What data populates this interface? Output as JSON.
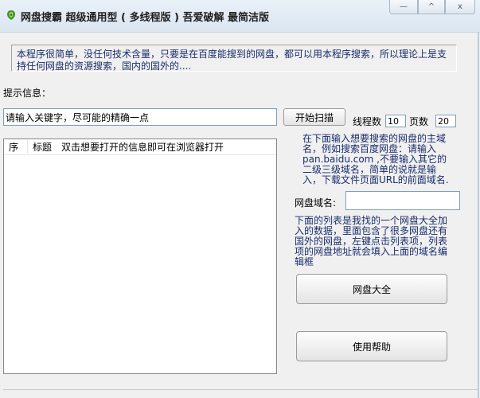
{
  "window": {
    "title": "网盘搜霸 超级通用型 ( 多线程版 )   吾爱破解 最简洁版",
    "minimize_label": "—",
    "maximize_label": "^",
    "close_label": "x"
  },
  "intro_text": "本程序很简单，没任何技术含量，只要是在百度能搜到的网盘，都可以用本程序搜索，所以理论上是支持任何网盘的资源搜索，国内的国外的....",
  "hint_label": "提示信息：",
  "keyword_input": {
    "value": "请输入关键字，尽可能的精确一点"
  },
  "scan_button": "开始扫描",
  "threads": {
    "label": "线程数",
    "value": "10"
  },
  "pages": {
    "label": "页数",
    "value": "20"
  },
  "result_list": {
    "columns": [
      "序",
      "标题",
      "双击想要打开的信息即可在浏览器打开"
    ]
  },
  "description_top": "在下面输入想要搜索的网盘的主域名，例如搜索百度网盘：请输入pan.baidu.com ,不要输入其它的二级三级域名，简单的说就是输入，下载文件页面URL的前面域名.",
  "domain": {
    "label": "网盘域名:",
    "value": ""
  },
  "description_bottom": "下面的列表是我找的一个网盘大全加入的数据，里面包含了很多网盘还有国外的网盘，左键点击列表项，列表项的网盘地址就会填入上面的域名编辑框",
  "all_drives_button": "网盘大全",
  "help_button": "使用帮助",
  "colors": {
    "accent_text": "#1a2d6b",
    "titlebar": "#dbe6f1"
  }
}
